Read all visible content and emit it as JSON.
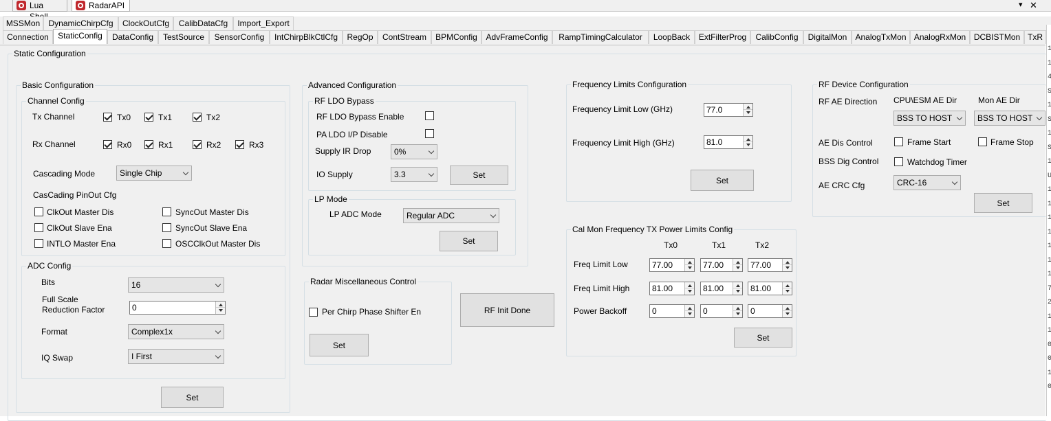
{
  "window": {
    "doc_tabs": [
      {
        "label": "Lua Shell"
      },
      {
        "label": "RadarAPI"
      }
    ],
    "controls": {
      "dropdown": "▾",
      "close": "✕"
    }
  },
  "tabs_row1": [
    "MSSMon",
    "DynamicChirpCfg",
    "ClockOutCfg",
    "CalibDataCfg",
    "Import_Export"
  ],
  "tabs_row2": [
    "Connection",
    "StaticConfig",
    "DataConfig",
    "TestSource",
    "SensorConfig",
    "IntChirpBlkCtlCfg",
    "RegOp",
    "ContStream",
    "BPMConfig",
    "AdvFrameConfig",
    "RampTimingCalculator",
    "LoopBack",
    "ExtFilterProg",
    "CalibConfig",
    "DigitalMon",
    "AnalogTxMon",
    "AnalogRxMon",
    "DCBISTMon",
    "TxR"
  ],
  "static_configuration": {
    "title": "Static Configuration"
  },
  "basic": {
    "title": "Basic Configuration",
    "channel_config": {
      "title": "Channel Config",
      "tx_label": "Tx Channel",
      "tx": [
        {
          "label": "Tx0",
          "checked": true
        },
        {
          "label": "Tx1",
          "checked": true
        },
        {
          "label": "Tx2",
          "checked": true
        }
      ],
      "rx_label": "Rx Channel",
      "rx": [
        {
          "label": "Rx0",
          "checked": true
        },
        {
          "label": "Rx1",
          "checked": true
        },
        {
          "label": "Rx2",
          "checked": true
        },
        {
          "label": "Rx3",
          "checked": true
        }
      ],
      "cascading_label": "Cascading Mode",
      "cascading_value": "Single Chip",
      "pinout_label": "CasCading PinOut Cfg",
      "pinout": [
        {
          "label": "ClkOut Master Dis",
          "checked": false
        },
        {
          "label": "SyncOut Master Dis",
          "checked": false
        },
        {
          "label": "ClkOut Slave Ena",
          "checked": false
        },
        {
          "label": "SyncOut Slave Ena",
          "checked": false
        },
        {
          "label": "INTLO Master Ena",
          "checked": false
        },
        {
          "label": "OSCClkOut Master Dis",
          "checked": false
        }
      ]
    },
    "adc_config": {
      "title": "ADC Config",
      "bits_label": "Bits",
      "bits_value": "16",
      "fsrf_label_1": "Full Scale",
      "fsrf_label_2": "Reduction Factor",
      "fsrf_value": "0",
      "format_label": "Format",
      "format_value": "Complex1x",
      "iq_label": "IQ Swap",
      "iq_value": "I First"
    },
    "set_label": "Set"
  },
  "advanced": {
    "title": "Advanced Configuration",
    "rf_ldo": {
      "title": "RF LDO Bypass",
      "bypass_label": "RF LDO Bypass Enable",
      "pa_label": "PA LDO I/P Disable",
      "ir_drop_label": "Supply IR Drop",
      "ir_drop_value": "0%",
      "io_supply_label": "IO Supply",
      "io_supply_value": "3.3",
      "set_label": "Set"
    },
    "lp_mode": {
      "title": "LP Mode",
      "label": "LP ADC Mode",
      "value": "Regular ADC",
      "set_label": "Set"
    }
  },
  "radar_misc": {
    "title": "Radar Miscellaneous Control",
    "phase_label": "Per Chirp Phase Shifter En",
    "set_label": "Set"
  },
  "rf_init_done": "RF Init Done",
  "freq_limits": {
    "title": "Frequency Limits Configuration",
    "low_label": "Frequency Limit Low (GHz)",
    "low_value": "77.0",
    "high_label": "Frequency Limit High (GHz)",
    "high_value": "81.0",
    "set_label": "Set"
  },
  "calmon": {
    "title": "Cal Mon Frequency TX Power Limits Config",
    "columns": [
      "Tx0",
      "Tx1",
      "Tx2"
    ],
    "rows": [
      {
        "label": "Freq Limit Low",
        "values": [
          "77.00",
          "77.00",
          "77.00"
        ]
      },
      {
        "label": "Freq Limit High",
        "values": [
          "81.00",
          "81.00",
          "81.00"
        ]
      },
      {
        "label": "Power Backoff",
        "values": [
          "0",
          "0",
          "0"
        ]
      }
    ],
    "set_label": "Set"
  },
  "rf_device": {
    "title": "RF Device Configuration",
    "ae_dir_label": "RF AE Direction",
    "cpu_header": "CPU\\ESM AE Dir",
    "mon_header": "Mon AE Dir",
    "cpu_value": "BSS TO HOST",
    "mon_value": "BSS TO HOST",
    "ae_dis_label": "AE Dis Control",
    "frame_start": "Frame Start",
    "frame_stop": "Frame Stop",
    "bss_dig_label": "BSS Dig Control",
    "watchdog": "Watchdog Timer",
    "crc_label": "AE CRC Cfg",
    "crc_value": "CRC-16",
    "set_label": "Set"
  },
  "right_edge_glyphs": [
    "1",
    "1",
    "4",
    "S",
    "1",
    "S",
    "1",
    "S",
    "1",
    "U",
    "1",
    "1",
    "1",
    "1",
    "1",
    "1",
    "1",
    "7",
    "2",
    "1",
    "1",
    "0",
    "0",
    "1",
    "0"
  ]
}
